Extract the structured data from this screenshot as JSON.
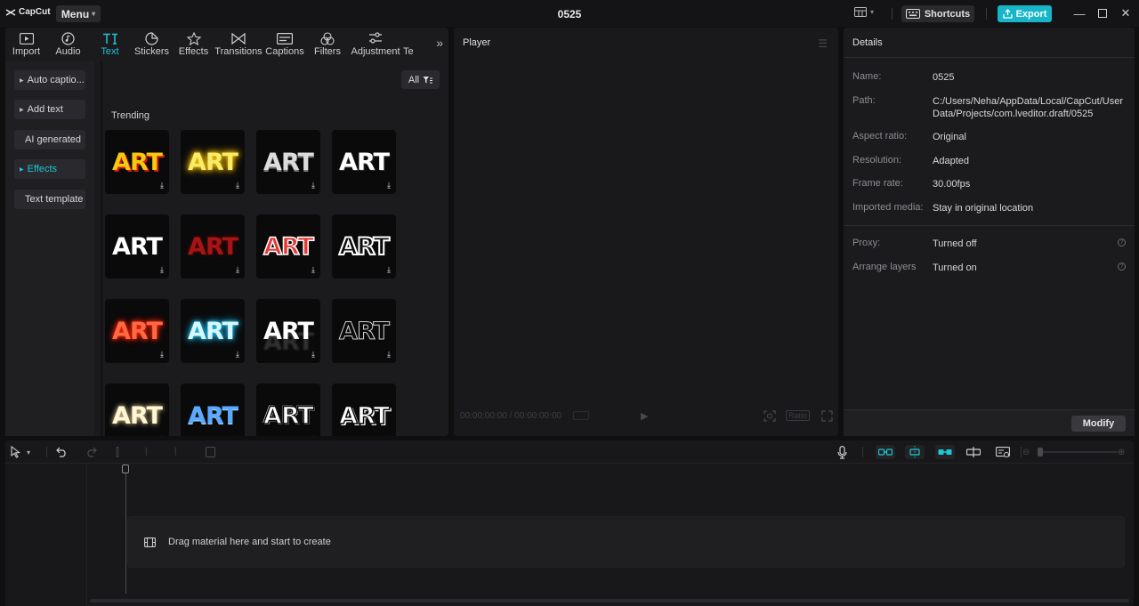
{
  "app": {
    "logo_text": "CapCut",
    "menu_label": "Menu",
    "project_title": "0525",
    "shortcuts_label": "Shortcuts",
    "export_label": "Export",
    "accent_color": "#16b6c8"
  },
  "tabs": [
    {
      "label": "Import",
      "icon": "import-icon"
    },
    {
      "label": "Audio",
      "icon": "audio-icon"
    },
    {
      "label": "Text",
      "icon": "text-icon",
      "active": true
    },
    {
      "label": "Stickers",
      "icon": "stickers-icon"
    },
    {
      "label": "Effects",
      "icon": "effects-icon"
    },
    {
      "label": "Transitions",
      "icon": "transitions-icon"
    },
    {
      "label": "Captions",
      "icon": "captions-icon"
    },
    {
      "label": "Filters",
      "icon": "filters-icon"
    },
    {
      "label": "Adjustment",
      "icon": "adjustment-icon"
    },
    {
      "label": "Te",
      "icon": ""
    }
  ],
  "submenu": [
    {
      "label": "Auto captio...",
      "arrow": true
    },
    {
      "label": "Add text",
      "arrow": true
    },
    {
      "label": "AI generated",
      "arrow": false
    },
    {
      "label": "Effects",
      "arrow": true,
      "active": true
    },
    {
      "label": "Text template",
      "arrow": false
    }
  ],
  "filter": {
    "label": "All"
  },
  "section_title": "Trending",
  "tiles": [
    {
      "text": "ART",
      "color": "#f6c90e",
      "style": "yellow-red"
    },
    {
      "text": "ART",
      "color": "#f4e04a",
      "style": "glow-yellow"
    },
    {
      "text": "ART",
      "color": "#d9d9d9",
      "style": "silver"
    },
    {
      "text": "ART",
      "color": "#ffffff",
      "style": "white-outline"
    },
    {
      "text": "ART",
      "color": "#ffffff",
      "style": "white-shadow"
    },
    {
      "text": "ART",
      "color": "#b01818",
      "style": "dark-red"
    },
    {
      "text": "ART",
      "color": "#e53935",
      "style": "red-white"
    },
    {
      "text": "ART",
      "color": "#000000",
      "style": "black-outline"
    },
    {
      "text": "ART",
      "color": "#ff5a36",
      "style": "neon-red"
    },
    {
      "text": "ART",
      "color": "#c8f4ff",
      "style": "neon-blue"
    },
    {
      "text": "ART",
      "color": "#ffffff",
      "style": "white-reflect"
    },
    {
      "text": "ART",
      "color": "#0a0a0b",
      "style": "outline-thin"
    },
    {
      "text": "ART",
      "color": "#fff6d6",
      "style": "soft-glow"
    },
    {
      "text": "ART",
      "color": "#5aa9ff",
      "style": "blue-gradient"
    },
    {
      "text": "ART",
      "color": "#ffffff",
      "style": "sketch"
    },
    {
      "text": "ART",
      "color": "#ffffff",
      "style": "bold-outline"
    }
  ],
  "player": {
    "title": "Player",
    "timecode": "00:00:00:00 / 00:00:00:00",
    "ratio_label": "Ratio"
  },
  "details": {
    "title": "Details",
    "rows": [
      {
        "label": "Name:",
        "value": "0525"
      },
      {
        "label": "Path:",
        "value": "C:/Users/Neha/AppData/Local/CapCut/User Data/Projects/com.lveditor.draft/0525"
      },
      {
        "label": "Aspect ratio:",
        "value": "Original"
      },
      {
        "label": "Resolution:",
        "value": "Adapted"
      },
      {
        "label": "Frame rate:",
        "value": "30.00fps"
      },
      {
        "label": "Imported media:",
        "value": "Stay in original location"
      }
    ],
    "settings": [
      {
        "label": "Proxy:",
        "value": "Turned off"
      },
      {
        "label": "Arrange layers",
        "value": "Turned on"
      }
    ],
    "modify_label": "Modify"
  },
  "timeline": {
    "drop_hint": "Drag material here and start to create"
  }
}
